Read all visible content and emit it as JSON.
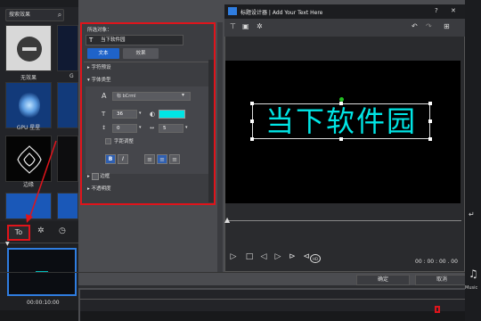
{
  "library": {
    "search_placeholder": "搜索效果",
    "items": [
      {
        "label": "无效果"
      },
      {
        "label": "G"
      },
      {
        "label": "GPU 星星"
      },
      {
        "label": "边缘"
      }
    ]
  },
  "window": {
    "title": "标题设计器 | Add Your Text Here",
    "help": "?",
    "close": "✕"
  },
  "panel": {
    "selected_label": "所选对象：",
    "object_name": "当下软件园",
    "tab_text": "文本",
    "tab_effect": "效果",
    "sections": {
      "preset": "字符预设",
      "font_type": "字体类型",
      "border": "边框",
      "opacity": "不透明度"
    },
    "font_name": "标 bCrml",
    "font_size": "36",
    "line_spacing": "0",
    "char_spacing": "5",
    "kerning": "字距调整",
    "bold": "B",
    "italic": "I",
    "fill_color": "#00e5e5"
  },
  "preview": {
    "text": "当下软件园",
    "text_color": "#00e5e5",
    "timecode": "00 : 00 : 00 . 00"
  },
  "buttons": {
    "ok": "确定",
    "cancel": "取消"
  },
  "timeline": {
    "tool_label": "To",
    "time": "00:00:10:00"
  },
  "right_strip": {
    "music": "Music"
  }
}
